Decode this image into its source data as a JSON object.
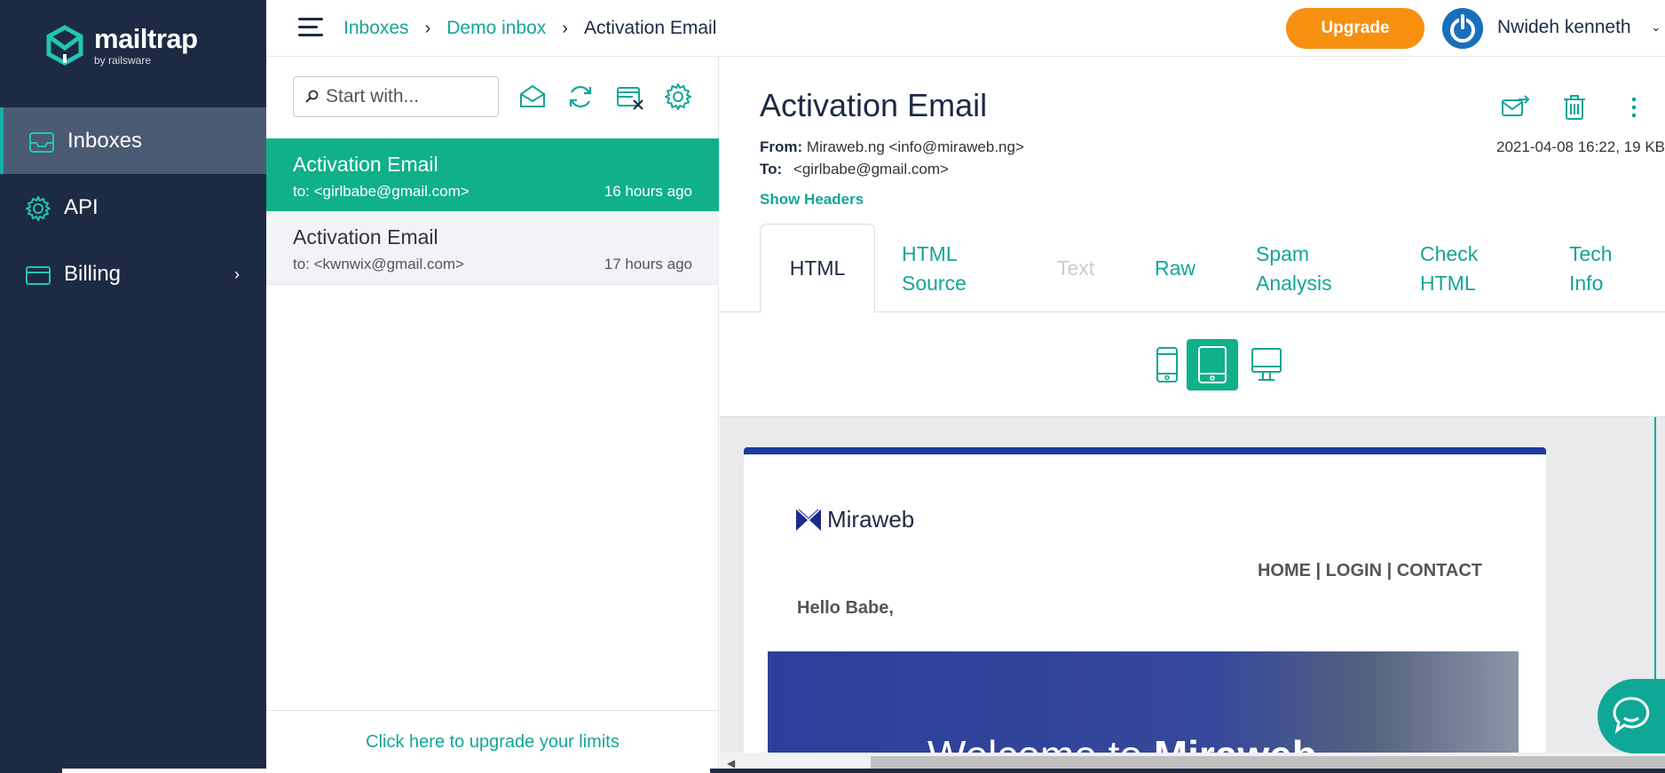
{
  "sidebar": {
    "logo": {
      "name": "mailtrap",
      "tagline": "by railsware"
    },
    "items": [
      {
        "label": "Inboxes",
        "icon": "inbox-icon",
        "active": true
      },
      {
        "label": "API",
        "icon": "gear-icon",
        "active": false
      },
      {
        "label": "Billing",
        "icon": "card-icon",
        "active": false,
        "has_submenu": true
      }
    ]
  },
  "topbar": {
    "breadcrumbs": [
      "Inboxes",
      "Demo inbox",
      "Activation Email"
    ],
    "separator": "›",
    "upgrade_label": "Upgrade",
    "user_name": "Nwideh kenneth"
  },
  "list": {
    "search_placeholder": "Start with...",
    "toolbar_icons": [
      "mark-read-icon",
      "refresh-icon",
      "clear-inbox-icon",
      "settings-icon"
    ],
    "messages": [
      {
        "subject": "Activation Email",
        "to": "to: <girlbabe@gmail.com>",
        "ago": "16 hours ago",
        "selected": true
      },
      {
        "subject": "Activation Email",
        "to": "to: <kwnwix@gmail.com>",
        "ago": "17 hours ago",
        "selected": false
      }
    ],
    "upgrade_limits": "Click here to upgrade your limits"
  },
  "detail": {
    "title": "Activation Email",
    "from_label": "From:",
    "from_value": "Miraweb.ng <info@miraweb.ng>",
    "to_label": "To:",
    "to_value": "<girlbabe@gmail.com>",
    "date": "2021-04-08 16:22, 19 KB",
    "show_headers": "Show Headers",
    "tabs": [
      {
        "line1": "HTML",
        "line2": "",
        "state": "active"
      },
      {
        "line1": "HTML",
        "line2": "Source",
        "state": "normal"
      },
      {
        "line1": "Text",
        "line2": "",
        "state": "disabled"
      },
      {
        "line1": "Raw",
        "line2": "",
        "state": "normal"
      },
      {
        "line1": "Spam",
        "line2": "Analysis",
        "state": "normal"
      },
      {
        "line1": "Check",
        "line2": "HTML",
        "state": "normal"
      },
      {
        "line1": "Tech",
        "line2": "Info",
        "state": "normal"
      }
    ],
    "devices": [
      "phone-icon",
      "tablet-icon",
      "desktop-icon"
    ],
    "active_device": "tablet"
  },
  "preview": {
    "brand": "Miraweb",
    "nav": "HOME | LOGIN | CONTACT",
    "greeting": "Hello Babe,",
    "banner_text": "Welcome to",
    "banner_brand": "Miraweb"
  },
  "colors": {
    "sidebar": "#1d2a44",
    "accent": "#13a596",
    "selected": "#0fb08a",
    "upgrade": "#f7900e",
    "mail_bar": "#1c3a9e"
  }
}
